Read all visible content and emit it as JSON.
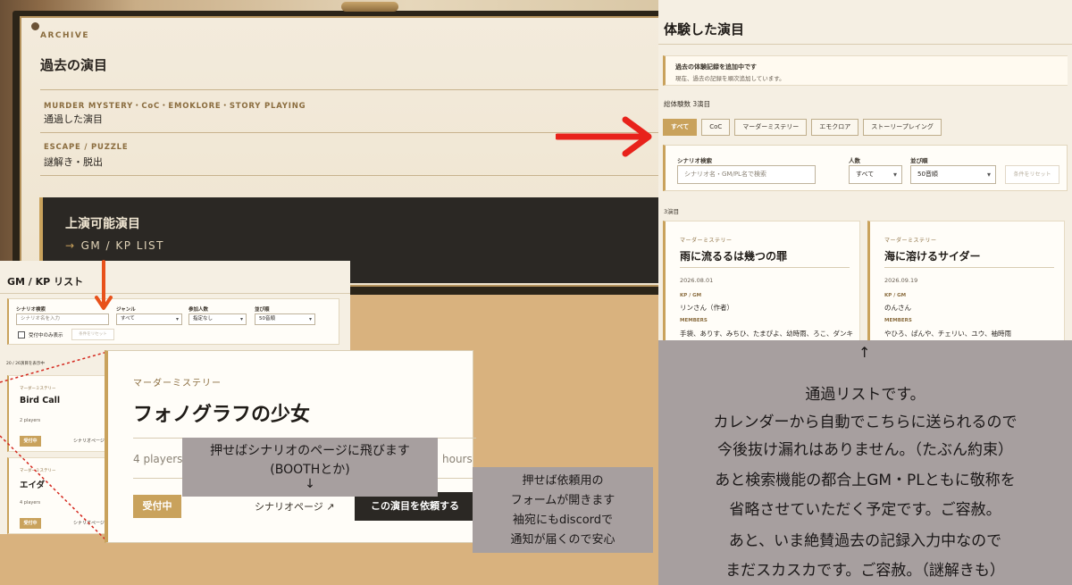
{
  "archive": {
    "label": "ARCHIVE",
    "title": "過去の演目",
    "categories": [
      {
        "label": "MURDER MYSTERY・CoC・EMOKLORE・STORY PLAYING",
        "name": "通過した演目"
      },
      {
        "label": "ESCAPE / PUZZLE",
        "name": "謎解き・脱出"
      }
    ],
    "gm_panel": {
      "title": "上演可能演目",
      "arrow": "→",
      "subtitle": "GM / KP LIST"
    }
  },
  "played": {
    "title": "体験した演目",
    "notice_title": "過去の体験記録を追加中です",
    "notice_text": "現在、過去の記録を順次追加しています。",
    "total": "総体験数 3演目",
    "tabs": [
      "すべて",
      "CoC",
      "マーダーミステリー",
      "エモクロア",
      "ストーリープレイング"
    ],
    "search": {
      "scenario_label": "シナリオ検索",
      "scenario_placeholder": "シナリオ名・GM/PL名で検索",
      "people_label": "人数",
      "people_value": "すべて",
      "sort_label": "並び順",
      "sort_value": "50音順",
      "reset": "条件をリセット"
    },
    "count": "3演目",
    "cards": [
      {
        "category": "マーダーミステリー",
        "title": "雨に流るるは幾つの罪",
        "date": "2026.08.01",
        "kp_label": "KP / GM",
        "kp": "リンさん（作者）",
        "members_label": "MEMBERS",
        "members": "手袋、ありす、みちひ、たまぴよ、幼時雨、ろこ、ダンキーバー"
      },
      {
        "category": "マーダーミステリー",
        "title": "海に溶けるサイダー",
        "date": "2026.09.19",
        "kp_label": "KP / GM",
        "kp": "のんさん",
        "members_label": "MEMBERS",
        "members": "やひろ、ぱんや、チェリい、ユウ、袖時雨"
      }
    ]
  },
  "note": {
    "arrow": "↑",
    "lines": [
      "通過リストです。",
      "カレンダーから自動でこちらに送られるので",
      "今後抜け漏れはありません。（たぶん約束）",
      "あと検索機能の都合上GM・PLともに敬称を",
      "省略させていただく予定です。ご容赦。",
      "あと、いま絶賛過去の記録入力中なので",
      "まだスカスカです。ご容赦。（謎解きも）"
    ]
  },
  "gm_list": {
    "title": "GM / KP リスト",
    "search": {
      "scenario_label": "シナリオ検索",
      "scenario_placeholder": "シナリオ名を入力",
      "genre_label": "ジャンル",
      "genre_value": "すべて",
      "people_label": "参加人数",
      "people_value": "指定なし",
      "sort_label": "並び順",
      "sort_value": "50音順",
      "accepting_only": "受付中のみ表示",
      "reset": "条件をリセット"
    },
    "count": "20 / 26演目を表示中",
    "cards": [
      {
        "category": "マーダーミステリー",
        "title": "Bird Call",
        "players": "2 players",
        "badge": "受付中",
        "link": "シナリオページ ↗"
      },
      {
        "category": "マーダーミステリー",
        "title": "エイダ",
        "players": "4 players",
        "badge": "受付中",
        "link": "シナリオページ ↗"
      }
    ]
  },
  "zoom_card": {
    "category": "マーダーミステリー",
    "title": "フォノグラフの少女",
    "players": "4 players",
    "hours": "hours",
    "badge": "受付中",
    "link": "シナリオページ ↗",
    "request": "この演目を依頼する"
  },
  "bubble_scenario": {
    "lines": [
      "押せばシナリオのページに飛びます",
      "(BOOTHとか)",
      "↓"
    ]
  },
  "bubble_request": {
    "arrow": "←",
    "lines": [
      "押せば依頼用の",
      "フォームが開きます",
      "袖宛にもdiscordで",
      "通知が届くので安心"
    ]
  },
  "colors": {
    "accent": "#c9a25c",
    "dark": "#2b2824",
    "red_arrow": "#e8221b",
    "note_bg": "#a79f9f"
  }
}
